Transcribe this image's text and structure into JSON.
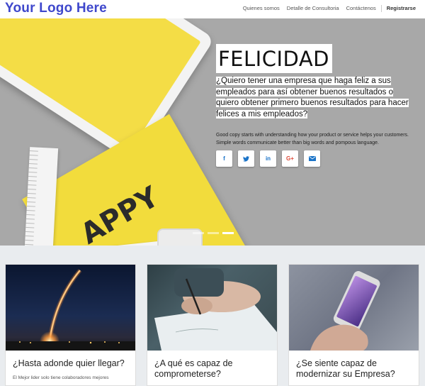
{
  "brand": {
    "logo_text": "Your Logo Here"
  },
  "nav": {
    "items": [
      "Quienes somos",
      "Detalle de Consultoria",
      "Contáctenos"
    ],
    "register": "Registrarse"
  },
  "hero": {
    "title": "FELICIDAD",
    "subtitle": "¿Quiero tener una empresa que haga feliz a sus empleados para así obtener buenos resultados o quiero obtener primero buenos resultados para hacer felices a mis empleados?",
    "description": "Good copy starts with understanding how your product or service helps your customers. Simple words communicate better than big words and pompous language.",
    "envelope_text": "APPY",
    "social": [
      "f",
      "t",
      "in",
      "G+",
      "✉"
    ],
    "slides": 3,
    "active_slide": 3
  },
  "cards": [
    {
      "title": "¿Hasta adonde quier llegar?",
      "text": "El Mejor lider solo tiene colaboradores mejores"
    },
    {
      "title": "¿A qué es capaz de comprometerse?",
      "text": ""
    },
    {
      "title": "¿Se siente capaz de modernizar su Empresa?",
      "text": ""
    }
  ]
}
